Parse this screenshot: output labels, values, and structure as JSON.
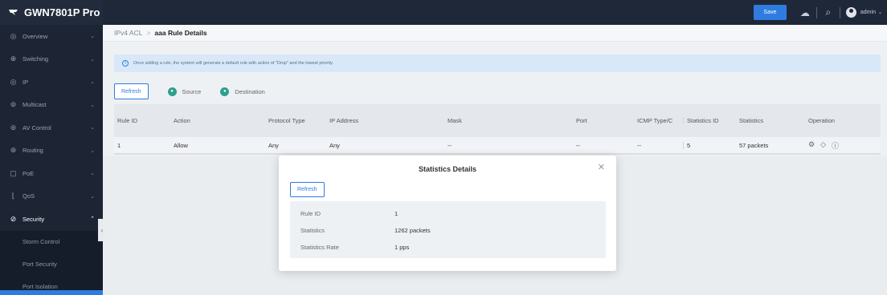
{
  "header": {
    "product_name": "GWN7801P Pro",
    "save_label": "Save",
    "user_label": "admin"
  },
  "sidebar": {
    "items": [
      {
        "label": "Overview",
        "icon": "overview-icon",
        "glyph": "◎"
      },
      {
        "label": "Switching",
        "icon": "switching-icon",
        "glyph": "⊕"
      },
      {
        "label": "IP",
        "icon": "ip-icon",
        "glyph": "◎"
      },
      {
        "label": "Multicast",
        "icon": "multicast-icon",
        "glyph": "⊜"
      },
      {
        "label": "AV Control",
        "icon": "av-control-icon",
        "glyph": "⊜"
      },
      {
        "label": "Routing",
        "icon": "routing-icon",
        "glyph": "⊛"
      },
      {
        "label": "PoE",
        "icon": "poe-icon",
        "glyph": "▢"
      },
      {
        "label": "QoS",
        "icon": "qos-icon",
        "glyph": "⌊"
      },
      {
        "label": "Security",
        "icon": "security-icon",
        "glyph": "⊘"
      }
    ],
    "sub_items": [
      "Storm Control",
      "Port Security",
      "Port Isolation"
    ]
  },
  "breadcrumb": {
    "parent": "IPv4 ACL",
    "separator": ">",
    "current": "aaa Rule Details"
  },
  "notice": "Once adding a rule, the system will generate a default rule with action of \"Drop\" and the lowest priority.",
  "toolbar": {
    "refresh_label": "Refresh",
    "source_label": "Source",
    "destination_label": "Destination"
  },
  "table": {
    "columns": [
      "Rule ID",
      "Action",
      "Protocol Type",
      "IP Address",
      "Mask",
      "Port",
      "ICMP Type/C",
      "Statistics ID",
      "Statistics",
      "Operation"
    ],
    "rows": [
      [
        "1",
        "Allow",
        "Any",
        "Any",
        "--",
        "--",
        "--",
        "5",
        "57 packets"
      ]
    ]
  },
  "modal": {
    "title": "Statistics Details",
    "refresh_label": "Refresh",
    "rows": [
      {
        "label": "Rule ID",
        "value": "1"
      },
      {
        "label": "Statistics",
        "value": "1262 packets"
      },
      {
        "label": "Statistics Rate",
        "value": "1 pps"
      }
    ]
  },
  "colors": {
    "accent": "#2f7ce0",
    "topbar": "#1f2838",
    "sidebar": "#1d2534",
    "info_bar": "#d9e8f8"
  }
}
